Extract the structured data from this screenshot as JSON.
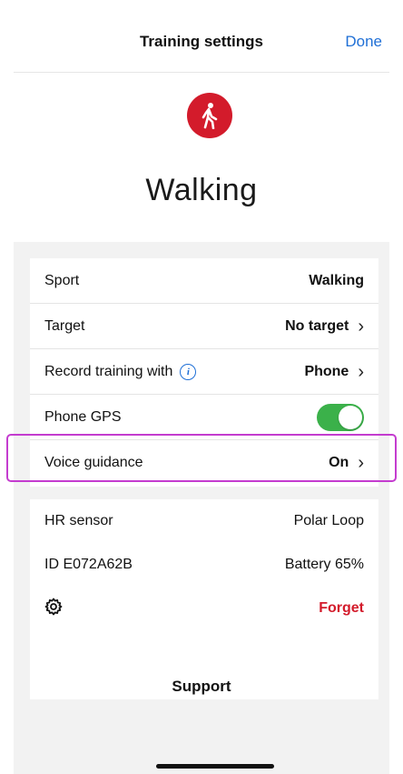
{
  "nav": {
    "title": "Training settings",
    "done_label": "Done"
  },
  "hero": {
    "sport_icon": "walking-person-icon",
    "sport_name": "Walking"
  },
  "settings": {
    "sport": {
      "label": "Sport",
      "value": "Walking"
    },
    "target": {
      "label": "Target",
      "value": "No target"
    },
    "record": {
      "label": "Record training with",
      "value": "Phone",
      "info_icon": "info-icon"
    },
    "gps": {
      "label": "Phone GPS",
      "enabled": true
    },
    "voice": {
      "label": "Voice guidance",
      "value": "On"
    }
  },
  "sensor": {
    "hr_label": "HR sensor",
    "hr_value": "Polar Loop",
    "id_label": "ID E072A62B",
    "battery": "Battery 65%",
    "settings_icon": "gear-icon",
    "forget_label": "Forget"
  },
  "support_label": "Support",
  "colors": {
    "accent": "#1f6fd6",
    "brand_red": "#d31b2b",
    "toggle_on": "#3bb14a",
    "highlight": "#c43ccf"
  }
}
